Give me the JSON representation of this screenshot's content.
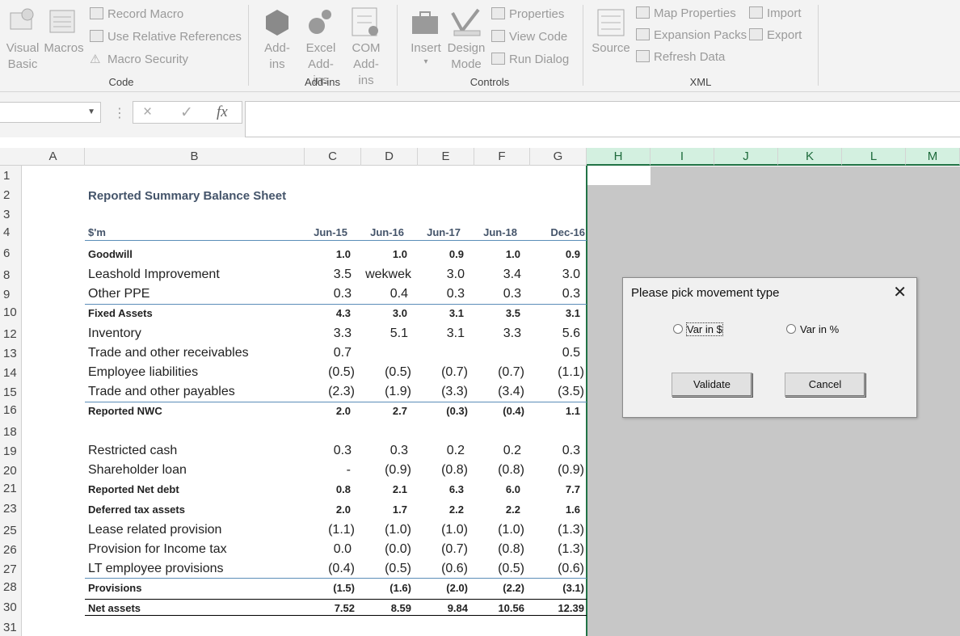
{
  "ribbon": {
    "code": {
      "visual_basic": "Visual Basic",
      "macros": "Macros",
      "record_macro": "Record Macro",
      "relative_refs": "Use Relative References",
      "macro_security": "Macro Security",
      "group": "Code"
    },
    "addins": {
      "addins": "Add-ins",
      "excel_addins": "Excel Add-ins",
      "com_addins": "COM Add-ins",
      "group": "Add-ins"
    },
    "controls": {
      "insert": "Insert",
      "design_mode": "Design Mode",
      "properties": "Properties",
      "view_code": "View Code",
      "run_dialog": "Run Dialog",
      "group": "Controls"
    },
    "xml": {
      "source": "Source",
      "map_properties": "Map Properties",
      "expansion_packs": "Expansion Packs",
      "refresh_data": "Refresh Data",
      "import": "Import",
      "export": "Export",
      "group": "XML"
    }
  },
  "formula_bar": {
    "cancel_icon": "×",
    "enter_icon": "✓",
    "fx": "fx",
    "value": ""
  },
  "columns": [
    "A",
    "B",
    "C",
    "D",
    "E",
    "F",
    "G",
    "H",
    "I",
    "J",
    "K",
    "L",
    "M"
  ],
  "rows": [
    "1",
    "2",
    "3",
    "4",
    "6",
    "8",
    "9",
    "10",
    "12",
    "13",
    "14",
    "15",
    "16",
    "18",
    "19",
    "20",
    "21",
    "23",
    "25",
    "26",
    "27",
    "28",
    "30",
    "31"
  ],
  "sheet": {
    "title": "Reported Summary Balance Sheet",
    "unit": "$'m",
    "periods": [
      "Jun-15",
      "Jun-16",
      "Jun-17",
      "Jun-18",
      "Dec-16"
    ],
    "lines": [
      {
        "label": "Goodwill",
        "bold": true,
        "values": [
          "1.0",
          "1.0",
          "0.9",
          "1.0",
          "0.9"
        ]
      },
      {
        "label": "Leashold Improvement",
        "bold": false,
        "values": [
          "3.5",
          "wekwek",
          "3.0",
          "3.4",
          "3.0"
        ]
      },
      {
        "label": "Other PPE",
        "bold": false,
        "values": [
          "0.3",
          "0.4",
          "0.3",
          "0.3",
          "0.3"
        ]
      },
      {
        "label": "Fixed Assets",
        "bold": true,
        "values": [
          "4.3",
          "3.0",
          "3.1",
          "3.5",
          "3.1"
        ]
      },
      {
        "label": "Inventory",
        "bold": false,
        "values": [
          "3.3",
          "5.1",
          "3.1",
          "3.3",
          "5.6"
        ]
      },
      {
        "label": "Trade and other receivables",
        "bold": false,
        "values": [
          "0.7",
          "",
          "",
          "",
          "0.5"
        ]
      },
      {
        "label": "Employee liabilities",
        "bold": false,
        "values": [
          "(0.5)",
          "(0.5)",
          "(0.7)",
          "(0.7)",
          "(1.1)"
        ]
      },
      {
        "label": "Trade and other payables",
        "bold": false,
        "values": [
          "(2.3)",
          "(1.9)",
          "(3.3)",
          "(3.4)",
          "(3.5)"
        ]
      },
      {
        "label": "Reported NWC",
        "bold": true,
        "values": [
          "2.0",
          "2.7",
          "(0.3)",
          "(0.4)",
          "1.1"
        ]
      },
      {
        "label": "Restricted cash",
        "bold": false,
        "values": [
          "0.3",
          "0.3",
          "0.2",
          "0.2",
          "0.3"
        ]
      },
      {
        "label": "Shareholder loan",
        "bold": false,
        "values": [
          "-",
          "(0.9)",
          "(0.8)",
          "(0.8)",
          "(0.9)"
        ]
      },
      {
        "label": "Reported Net debt",
        "bold": true,
        "values": [
          "0.8",
          "2.1",
          "6.3",
          "6.0",
          "7.7"
        ]
      },
      {
        "label": "Deferred tax assets",
        "bold": true,
        "values": [
          "2.0",
          "1.7",
          "2.2",
          "2.2",
          "1.6"
        ]
      },
      {
        "label": "Lease related provision",
        "bold": false,
        "values": [
          "(1.1)",
          "(1.0)",
          "(1.0)",
          "(1.0)",
          "(1.3)"
        ]
      },
      {
        "label": "Provision for Income tax",
        "bold": false,
        "values": [
          "0.0",
          "(0.0)",
          "(0.7)",
          "(0.8)",
          "(1.3)"
        ]
      },
      {
        "label": "LT employee provisions",
        "bold": false,
        "values": [
          "(0.4)",
          "(0.5)",
          "(0.6)",
          "(0.5)",
          "(0.6)"
        ]
      },
      {
        "label": "Provisions",
        "bold": true,
        "values": [
          "(1.5)",
          "(1.6)",
          "(2.0)",
          "(2.2)",
          "(3.1)"
        ]
      },
      {
        "label": "Net assets",
        "bold": true,
        "values": [
          "7.52",
          "8.59",
          "9.84",
          "10.56",
          "12.39"
        ]
      }
    ]
  },
  "dialog": {
    "title": "Please pick movement type",
    "close": "✕",
    "option_dollar": "Var in $",
    "option_percent": "Var in %",
    "validate": "Validate",
    "cancel": "Cancel"
  }
}
